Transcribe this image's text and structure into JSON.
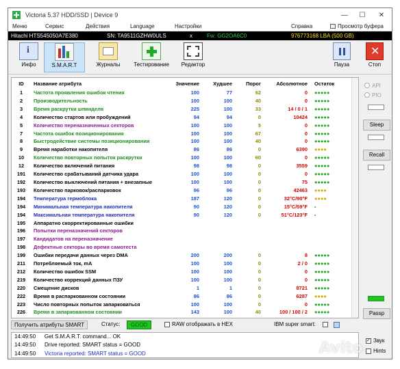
{
  "window": {
    "title": "Victoria 5.37 HDD/SSD | Device 9",
    "controls": [
      "minimize-icon",
      "maximize-icon",
      "close-icon"
    ]
  },
  "menu": {
    "items": [
      "Меню",
      "Сервис",
      "Действия",
      "Language",
      "Настройки",
      "Справка"
    ],
    "viewer": "Просмотр буфера"
  },
  "drive": {
    "model": "Hitachi HTS545050A7E380",
    "serial": "SN: TA9511GZHW0ULS",
    "sep": "x",
    "firmware": "Fw: GG2OA6C0",
    "lba": "976773168 LBA (500 GB)",
    "colors": {
      "model": "#ffffff",
      "serial": "#ffffff",
      "firmware": "#2ecc40",
      "lba": "#ffe000"
    }
  },
  "toolbar": {
    "buttons": [
      {
        "label": "Инфо",
        "icon": "info-icon"
      },
      {
        "label": "S.M.A.R.T",
        "icon": "smart-chart-icon"
      },
      {
        "label": "Журналы",
        "icon": "logs-folder-icon"
      },
      {
        "label": "Тестирование",
        "icon": "test-plus-icon"
      },
      {
        "label": "Редактор",
        "icon": "editor-chip-icon"
      }
    ],
    "pause_label": "Пауза",
    "stop_label": "Стоп"
  },
  "smart": {
    "headers": {
      "id": "ID",
      "name": "Название атрибута",
      "value": "Значение",
      "worst": "Худшее",
      "threshold": "Порог",
      "raw": "Абсолютное",
      "status": "Остаток"
    },
    "colors": {
      "green": "#1e8c1e",
      "blue": "#1c2fb8",
      "purple": "#8b1a8b",
      "black": "#000000",
      "raw_red": "#d40000",
      "thr_olive": "#8a8a00",
      "val_blue": "#1c50d0",
      "dots_green": "#22a822",
      "dots_yellow": "#d6a800"
    },
    "rows": [
      {
        "id": "1",
        "name": "Частота проявления ошибок чтения",
        "value": "100",
        "worst": "77",
        "threshold": "62",
        "raw": "0",
        "status": "●●●●●",
        "name_color": "green",
        "status_color": "dots_green"
      },
      {
        "id": "2",
        "name": "Производительность",
        "value": "100",
        "worst": "100",
        "threshold": "40",
        "raw": "0",
        "status": "●●●●●",
        "name_color": "green",
        "status_color": "dots_green"
      },
      {
        "id": "3",
        "name": "Время раскрутки шпинделя",
        "value": "225",
        "worst": "100",
        "threshold": "33",
        "raw": "14 / 0 / 1",
        "status": "●●●●●",
        "name_color": "green",
        "status_color": "dots_green"
      },
      {
        "id": "4",
        "name": "Количество стартов или пробуждений",
        "value": "94",
        "worst": "94",
        "threshold": "0",
        "raw": "10424",
        "status": "●●●●●",
        "name_color": "black",
        "status_color": "dots_green"
      },
      {
        "id": "5",
        "name": "Количество переназначенных секторов",
        "value": "100",
        "worst": "100",
        "threshold": "5",
        "raw": "0",
        "status": "●●●●●",
        "name_color": "purple",
        "status_color": "dots_green"
      },
      {
        "id": "7",
        "name": "Частота ошибок позиционирования",
        "value": "100",
        "worst": "100",
        "threshold": "67",
        "raw": "0",
        "status": "●●●●●",
        "name_color": "green",
        "status_color": "dots_green"
      },
      {
        "id": "8",
        "name": "Быстродействие системы позиционирования",
        "value": "100",
        "worst": "100",
        "threshold": "40",
        "raw": "0",
        "status": "●●●●●",
        "name_color": "green",
        "status_color": "dots_green"
      },
      {
        "id": "9",
        "name": "Время наработки накопителя",
        "value": "86",
        "worst": "86",
        "threshold": "0",
        "raw": "6390",
        "status": "●●●●",
        "name_color": "black",
        "status_color": "dots_yellow"
      },
      {
        "id": "10",
        "name": "Количество повторных попыток раскрутки",
        "value": "100",
        "worst": "100",
        "threshold": "60",
        "raw": "0",
        "status": "●●●●●",
        "name_color": "green",
        "status_color": "dots_green"
      },
      {
        "id": "12",
        "name": "Количество включений питания",
        "value": "98",
        "worst": "98",
        "threshold": "0",
        "raw": "3559",
        "status": "●●●●●",
        "name_color": "black",
        "status_color": "dots_green"
      },
      {
        "id": "191",
        "name": "Количество срабатываний датчика удара",
        "value": "100",
        "worst": "100",
        "threshold": "0",
        "raw": "0",
        "status": "●●●●●",
        "name_color": "black",
        "status_color": "dots_green"
      },
      {
        "id": "192",
        "name": "Количество выключений питания + внезапные",
        "value": "100",
        "worst": "100",
        "threshold": "0",
        "raw": "75",
        "status": "●●●●●",
        "name_color": "black",
        "status_color": "dots_green"
      },
      {
        "id": "193",
        "name": "Количество парковок/распарковок",
        "value": "96",
        "worst": "96",
        "threshold": "0",
        "raw": "42463",
        "status": "●●●●",
        "name_color": "black",
        "status_color": "dots_yellow"
      },
      {
        "id": "194",
        "name": "Температура гермоблока",
        "value": "187",
        "worst": "120",
        "threshold": "0",
        "raw": "32°C/90°F",
        "status": "●●●●",
        "name_color": "blue",
        "status_color": "dots_yellow"
      },
      {
        "id": "194",
        "name": "Минимальная температура накопителя",
        "value": "90",
        "worst": "120",
        "threshold": "0",
        "raw": "15°C/59°F",
        "status": "-",
        "name_color": "blue",
        "status_color": "black"
      },
      {
        "id": "194",
        "name": "Максимальная температура накопителя",
        "value": "90",
        "worst": "120",
        "threshold": "0",
        "raw": "51°C/123°F",
        "status": "-",
        "name_color": "blue",
        "status_color": "black"
      },
      {
        "id": "195",
        "name": "Аппаратно скорректированные ошибки",
        "value": "",
        "worst": "",
        "threshold": "",
        "raw": "",
        "status": "",
        "name_color": "black",
        "status_color": "black"
      },
      {
        "id": "196",
        "name": "Попытки переназначений секторов",
        "value": "",
        "worst": "",
        "threshold": "",
        "raw": "",
        "status": "",
        "name_color": "purple",
        "status_color": "black"
      },
      {
        "id": "197",
        "name": "Кандидатов на переназначение",
        "value": "",
        "worst": "",
        "threshold": "",
        "raw": "",
        "status": "",
        "name_color": "purple",
        "status_color": "black"
      },
      {
        "id": "198",
        "name": "Дефектные секторы во время самотеста",
        "value": "",
        "worst": "",
        "threshold": "",
        "raw": "",
        "status": "",
        "name_color": "purple",
        "status_color": "black"
      },
      {
        "id": "199",
        "name": "Ошибки передачи данных через DMA",
        "value": "200",
        "worst": "200",
        "threshold": "0",
        "raw": "8",
        "status": "●●●●●",
        "name_color": "black",
        "status_color": "dots_green"
      },
      {
        "id": "211",
        "name": "Потребляемый ток, mA",
        "value": "100",
        "worst": "100",
        "threshold": "0",
        "raw": "2 / 0",
        "status": "●●●●●",
        "name_color": "black",
        "status_color": "dots_green"
      },
      {
        "id": "212",
        "name": "Количество ошибок SSM",
        "value": "100",
        "worst": "100",
        "threshold": "0",
        "raw": "0",
        "status": "●●●●●",
        "name_color": "black",
        "status_color": "dots_green"
      },
      {
        "id": "219",
        "name": "Количество коррекций данных ПЗУ",
        "value": "100",
        "worst": "100",
        "threshold": "0",
        "raw": "0",
        "status": "●●●●●",
        "name_color": "black",
        "status_color": "dots_green"
      },
      {
        "id": "220",
        "name": "Смещение дисков",
        "value": "1",
        "worst": "1",
        "threshold": "0",
        "raw": "8721",
        "status": "●●●●●",
        "name_color": "black",
        "status_color": "dots_green"
      },
      {
        "id": "222",
        "name": "Время в распаркованном состоянии",
        "value": "86",
        "worst": "86",
        "threshold": "0",
        "raw": "6287",
        "status": "●●●●",
        "name_color": "black",
        "status_color": "dots_yellow"
      },
      {
        "id": "223",
        "name": "Число повторных попыток запарковаться",
        "value": "100",
        "worst": "100",
        "threshold": "0",
        "raw": "0",
        "status": "●●●●●",
        "name_color": "black",
        "status_color": "dots_green"
      },
      {
        "id": "226",
        "name": "Время в запаркованном состоянии",
        "value": "143",
        "worst": "100",
        "threshold": "40",
        "raw": "100 / 100 / 2",
        "status": "●●●●●",
        "name_color": "green",
        "status_color": "dots_green"
      }
    ]
  },
  "side": {
    "api_label": "API",
    "pio_label": "PIO",
    "sleep_label": "Sleep",
    "recall_label": "Recall",
    "passp_label": "Passp"
  },
  "bottom": {
    "get_smart_label": "Получить атрибуты SMART",
    "status_label": "Статус:",
    "status_value": "GOOD",
    "raw_hex_label": "RAW отображать в HEX",
    "ibm_label": "IBM super smart:"
  },
  "log": {
    "rows": [
      {
        "time": "14:49:50",
        "text": "Get S.M.A.R.T. command... OK",
        "color": "#000000"
      },
      {
        "time": "14:49:50",
        "text": "Drive reported: SMART status = GOOD",
        "color": "#000000"
      },
      {
        "time": "14:49:50",
        "text": "Victoria reported: SMART status = GOOD",
        "color": "#1c2fb8"
      }
    ],
    "sound_label": "Звук",
    "hints_label": "Hints"
  },
  "watermark": "Avito"
}
